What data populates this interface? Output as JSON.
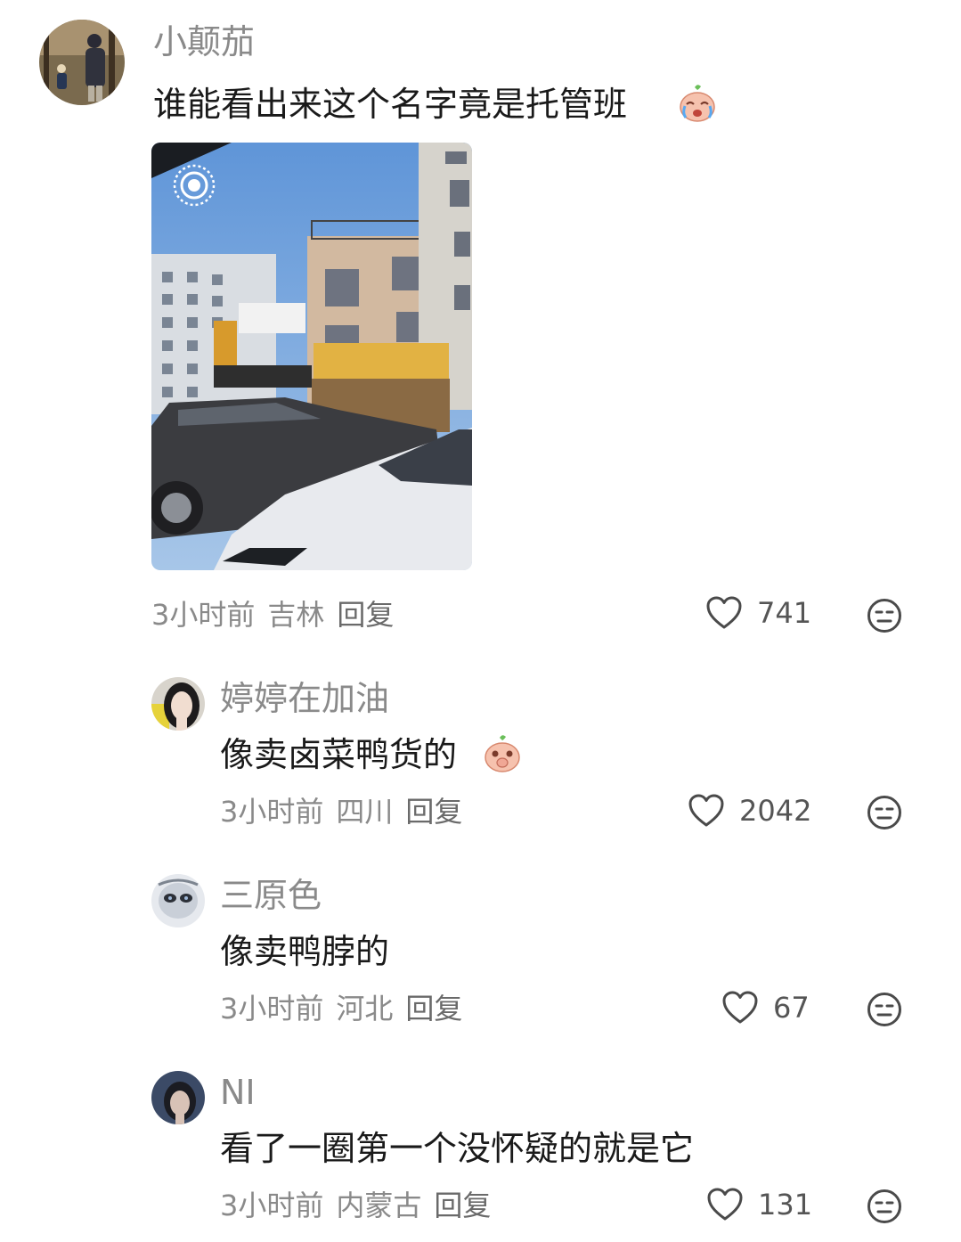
{
  "comments": [
    {
      "username": "小颠茄",
      "text": "谁能看出来这个名字竟是托管班",
      "emoji": "crying-face-emoji",
      "time": "3小时前",
      "location": "吉林",
      "reply": "回复",
      "likes": "741"
    },
    {
      "username": "婷婷在加油",
      "text": "像卖卤菜鸭货的",
      "emoji": "giggling-face-emoji",
      "time": "3小时前",
      "location": "四川",
      "reply": "回复",
      "likes": "2042"
    },
    {
      "username": "三原色",
      "text": "像卖鸭脖的",
      "time": "3小时前",
      "location": "河北",
      "reply": "回复",
      "likes": "67"
    },
    {
      "username": "NI",
      "text": "看了一圈第一个没怀疑的就是它",
      "time": "3小时前",
      "location": "内蒙古",
      "reply": "回复",
      "likes": "131"
    }
  ],
  "colors": {
    "muted_text": "#8a8a8a",
    "body_text": "#1a1a1a",
    "icon_stroke": "#4a4a4a"
  }
}
